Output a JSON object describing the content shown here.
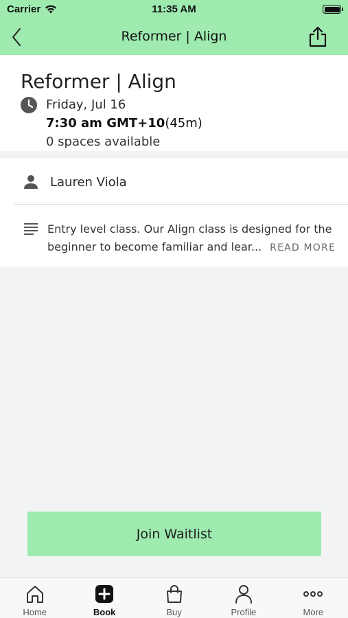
{
  "status_bar": {
    "carrier": "Carrier",
    "time": "11:35 AM"
  },
  "nav": {
    "title": "Reformer | Align"
  },
  "class": {
    "title": "Reformer | Align",
    "date": "Friday, Jul 16",
    "time": "7:30 am GMT+10",
    "duration": "(45m)",
    "spaces": "0 spaces available"
  },
  "details": {
    "instructor": "Lauren Viola",
    "description_line1": "Entry level class. Our Align class is designed for the",
    "description_line2": "beginner to become familiar and lear...",
    "read_more": "READ MORE"
  },
  "actions": {
    "join_waitlist": "Join Waitlist"
  },
  "tabs": [
    {
      "label": "Home",
      "icon": "home-icon"
    },
    {
      "label": "Book",
      "icon": "plus-square-icon",
      "active": true
    },
    {
      "label": "Buy",
      "icon": "shopping-bag-icon"
    },
    {
      "label": "Profile",
      "icon": "person-icon"
    },
    {
      "label": "More",
      "icon": "more-dots-icon"
    }
  ],
  "colors": {
    "accent": "#9eeaaf",
    "background": "#f2f3f5",
    "card": "#ffffff"
  }
}
